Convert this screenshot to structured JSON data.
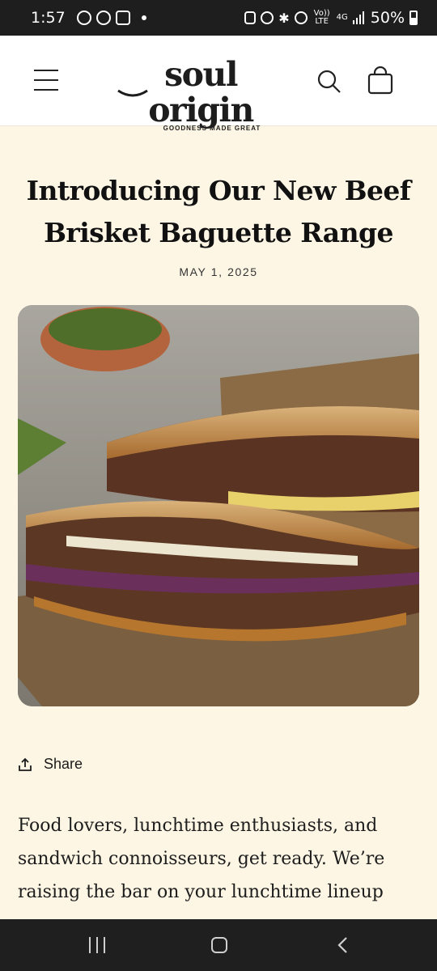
{
  "status_bar": {
    "time": "1:57",
    "network": "4G",
    "lte": "Vo)) LTE",
    "battery": "50%"
  },
  "header": {
    "logo_text": "soul origin",
    "logo_tagline": "GOODNESS MADE GREAT",
    "icons": [
      "menu-icon",
      "search-icon",
      "cart-icon"
    ]
  },
  "article": {
    "title": "Introducing Our New Beef Brisket Baguette Range",
    "date": "MAY 1, 2025",
    "share_label": "Share",
    "body": "Food lovers, lunchtime enthusiasts, and sandwich connoisseurs, get ready. We’re raising the bar on your lunchtime lineup"
  },
  "nav_bar": {
    "icons": [
      "recent-apps-icon",
      "home-icon",
      "back-icon"
    ]
  },
  "colors": {
    "page_background": "#fdf6e4",
    "header_background": "#ffffff",
    "text": "#1a1a1a"
  }
}
